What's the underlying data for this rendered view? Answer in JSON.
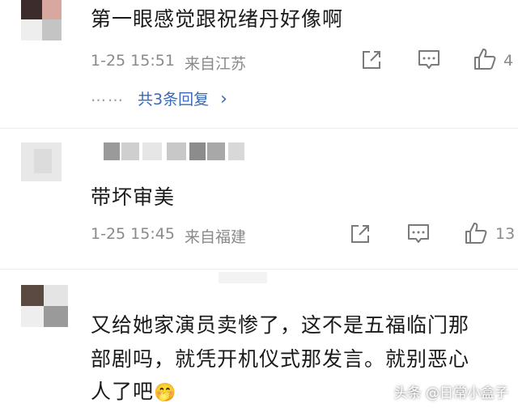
{
  "comments": [
    {
      "text": "第一眼感觉跟祝绪丹好像啊",
      "time": "1-25 15:51",
      "location": "来自江苏",
      "like_count": "4",
      "replies_dots": "……",
      "replies_label": "共3条回复",
      "replies_chevron": "›"
    },
    {
      "text": "带坏审美",
      "time": "1-25 15:45",
      "location": "来自福建",
      "like_count": "13"
    },
    {
      "text_line1": "又给她家演员卖惨了，这不是五福临门那",
      "text_line2": "部剧吗，就凭开机仪式那发言。就别恶心",
      "text_line3": "人了吧",
      "emoji": "🤭"
    }
  ],
  "icons": {
    "share": "share-icon",
    "comment": "comment-icon",
    "like": "thumbs-up-icon"
  },
  "watermark": "头条 @日常小盒子",
  "colors": {
    "link": "#3a68b2",
    "meta": "#8a8a8a",
    "icon": "#7a7a7a"
  }
}
